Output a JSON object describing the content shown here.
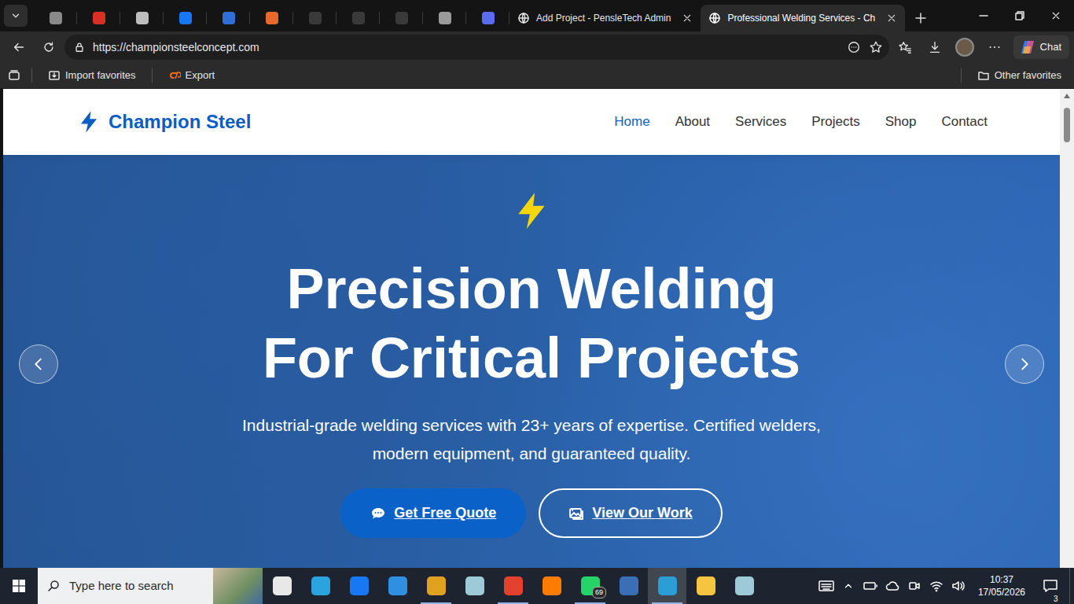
{
  "browser": {
    "tabs": [
      {
        "kind": "icon",
        "selected": false,
        "color": "#8a8a8a"
      },
      {
        "kind": "icon",
        "selected": false,
        "color": "#d93025"
      },
      {
        "kind": "icon",
        "selected": false,
        "color": "#bdbdbd"
      },
      {
        "kind": "icon",
        "selected": false,
        "color": "#1877f2"
      },
      {
        "kind": "icon",
        "selected": false,
        "color": "#2f6fd6"
      },
      {
        "kind": "icon",
        "selected": false,
        "color": "#e8692c"
      },
      {
        "kind": "icon",
        "selected": false,
        "color": "#3a3a3a"
      },
      {
        "kind": "icon",
        "selected": false,
        "color": "#3a3a3a"
      },
      {
        "kind": "icon",
        "selected": false,
        "color": "#3a3a3a"
      },
      {
        "kind": "icon",
        "selected": false,
        "color": "#9a9a9a"
      },
      {
        "kind": "icon",
        "selected": false,
        "color": "#5b6cf0"
      },
      {
        "kind": "text",
        "label": "Add Project - PensleTech Admin",
        "selected": false
      },
      {
        "kind": "text",
        "label": "Professional Welding Services - Ch",
        "selected": true
      }
    ],
    "address": "https://championsteelconcept.com",
    "chat_button": "Chat",
    "favorites_bar": {
      "items": [
        "Import favorites",
        "Export"
      ],
      "other": "Other favorites"
    }
  },
  "page": {
    "site": {
      "logo": "Champion Steel",
      "nav": [
        {
          "label": "Home",
          "selected": true
        },
        {
          "label": "About",
          "selected": false
        },
        {
          "label": "Services",
          "selected": false
        },
        {
          "label": "Projects",
          "selected": false
        },
        {
          "label": "Shop",
          "selected": false
        },
        {
          "label": "Contact",
          "selected": false
        }
      ]
    },
    "hero": {
      "title_lines": [
        "Precision Welding",
        "For Critical Projects"
      ],
      "text": "Industrial-grade welding services with 23+ years of expertise. Certified welders, modern equipment, and guaranteed quality.",
      "buttons": [
        {
          "label": "Get Free Quote",
          "kind": "primary"
        },
        {
          "label": "View Our Work",
          "kind": "outline"
        }
      ]
    }
  },
  "taskbar": {
    "search_placeholder": "Type here to search",
    "apps": [
      {
        "color": "#e8e8e8",
        "selected": false,
        "running": false
      },
      {
        "color": "#2aa3de",
        "selected": false,
        "running": false
      },
      {
        "color": "#1877f2",
        "selected": false,
        "running": false
      },
      {
        "color": "#2f8fe0",
        "selected": false,
        "running": false
      },
      {
        "color": "#e0a020",
        "selected": false,
        "running": true
      },
      {
        "color": "#9ec9d6",
        "selected": false,
        "running": false
      },
      {
        "color": "#e3412d",
        "selected": false,
        "running": true
      },
      {
        "color": "#ff7c00",
        "selected": false,
        "running": false
      },
      {
        "color": "#25d366",
        "selected": false,
        "running": true,
        "badge": "69"
      },
      {
        "color": "#3b6fb5",
        "selected": false,
        "running": false
      },
      {
        "color": "#2b9ed6",
        "selected": true,
        "running": true
      },
      {
        "color": "#f5c542",
        "selected": false,
        "running": false
      },
      {
        "color": "#9ec9d6",
        "selected": false,
        "running": false
      }
    ],
    "clock": {
      "time": "10:37",
      "date": "17/05/2026"
    },
    "notifications": "3"
  }
}
